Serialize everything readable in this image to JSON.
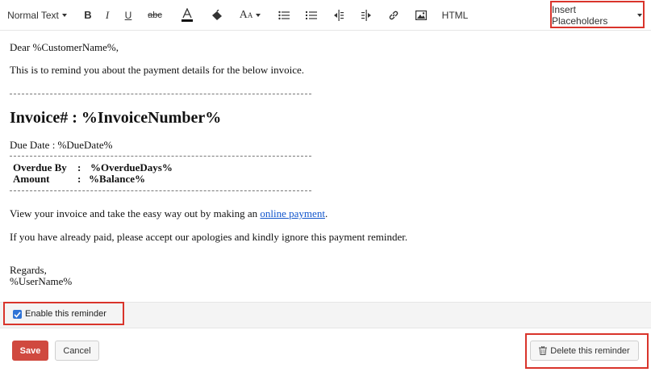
{
  "toolbar": {
    "format_label": "Normal Text",
    "bold_icon": "bold-icon",
    "italic_icon": "italic-icon",
    "underline_icon": "underline-icon",
    "strike_icon": "strikethrough-icon",
    "html_label": "HTML",
    "insert_placeholders_label": "Insert Placeholders"
  },
  "editor": {
    "greeting": "Dear %CustomerName%,",
    "intro": "This is to remind you about the payment details for the below invoice.",
    "invoice_title": "Invoice# : %InvoiceNumber%",
    "due_date": "Due Date :   %DueDate%",
    "overdue_label": "Overdue By",
    "overdue_sep": ":",
    "overdue_value": "%OverdueDays%",
    "amount_label": "Amount",
    "amount_sep": ":",
    "amount_value": "%Balance%",
    "view_text_before": "View your invoice and take the easy way out by making an ",
    "view_link": "online payment",
    "view_text_after": ".",
    "already_paid": "If you have already paid, please accept our apologies and kindly ignore this payment reminder.",
    "regards": "Regards,",
    "username": "%UserName%"
  },
  "reminder": {
    "enable_label": "Enable this reminder",
    "enabled": true
  },
  "actions": {
    "save_label": "Save",
    "cancel_label": "Cancel",
    "delete_label": "Delete this reminder"
  },
  "colors": {
    "highlight": "#d9342b",
    "save_button": "#d0493f",
    "checkbox": "#2f73d6",
    "link": "#1155cc"
  }
}
